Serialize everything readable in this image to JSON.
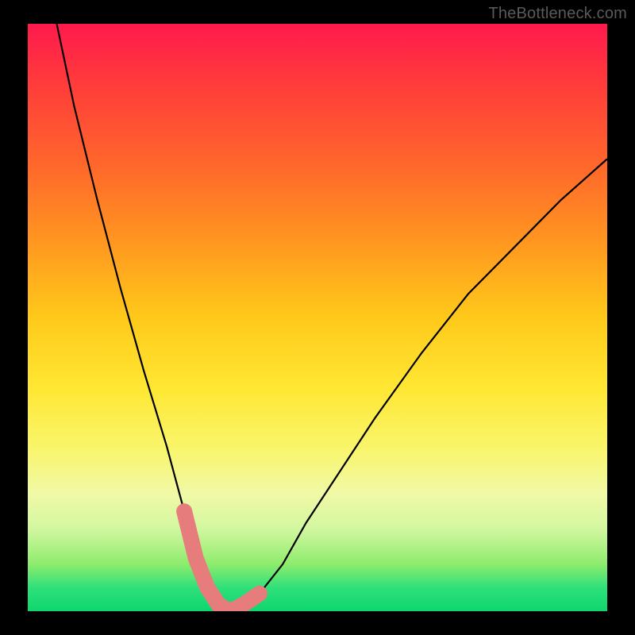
{
  "watermark": "TheBottleneck.com",
  "chart_data": {
    "type": "line",
    "title": "",
    "xlabel": "",
    "ylabel": "",
    "xlim": [
      0,
      100
    ],
    "ylim": [
      0,
      100
    ],
    "grid": false,
    "legend": false,
    "series": [
      {
        "name": "bottleneck-curve",
        "x": [
          5,
          8,
          12,
          16,
          20,
          24,
          27,
          29,
          31,
          33,
          35,
          37,
          40,
          44,
          48,
          54,
          60,
          68,
          76,
          85,
          92,
          100
        ],
        "y": [
          100,
          86,
          70,
          55,
          41,
          28,
          17,
          9,
          4,
          1,
          0,
          1,
          3,
          8,
          15,
          24,
          33,
          44,
          54,
          63,
          70,
          77
        ]
      },
      {
        "name": "highlight-band",
        "x": [
          27,
          29,
          31,
          33,
          35,
          37,
          40
        ],
        "y": [
          17,
          9,
          4,
          1,
          0,
          1,
          3
        ]
      }
    ],
    "annotations": [
      {
        "text": "TheBottleneck.com",
        "position": "top-right"
      }
    ]
  }
}
